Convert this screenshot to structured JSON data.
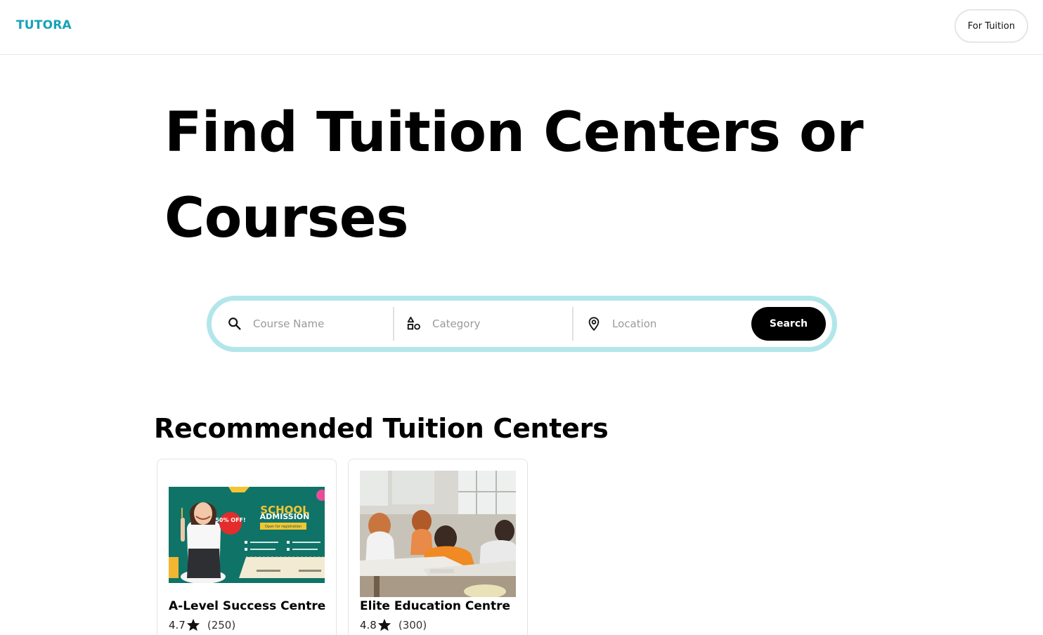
{
  "header": {
    "logo": "TUTORA",
    "cta_label": "For Tuition"
  },
  "hero": {
    "title": "Find Tuition Centers or Courses"
  },
  "search": {
    "course_placeholder": "Course Name",
    "category_placeholder": "Category",
    "location_placeholder": "Location",
    "button_label": "Search"
  },
  "recommended": {
    "title": "Recommended Tuition Centers",
    "centers": [
      {
        "name": "A-Level Success Centre",
        "rating": "4.7",
        "reviews": "(250)",
        "banner": {
          "discount": "50% OFF!",
          "heading": "SCHOOL",
          "subheading": "ADMISSION",
          "tag": "Open for registration"
        }
      },
      {
        "name": "Elite Education Centre",
        "rating": "4.8",
        "reviews": "(300)"
      }
    ]
  },
  "colors": {
    "brand": "#17a2b8",
    "search_border": "#b2e6ea",
    "button": "#000000"
  }
}
